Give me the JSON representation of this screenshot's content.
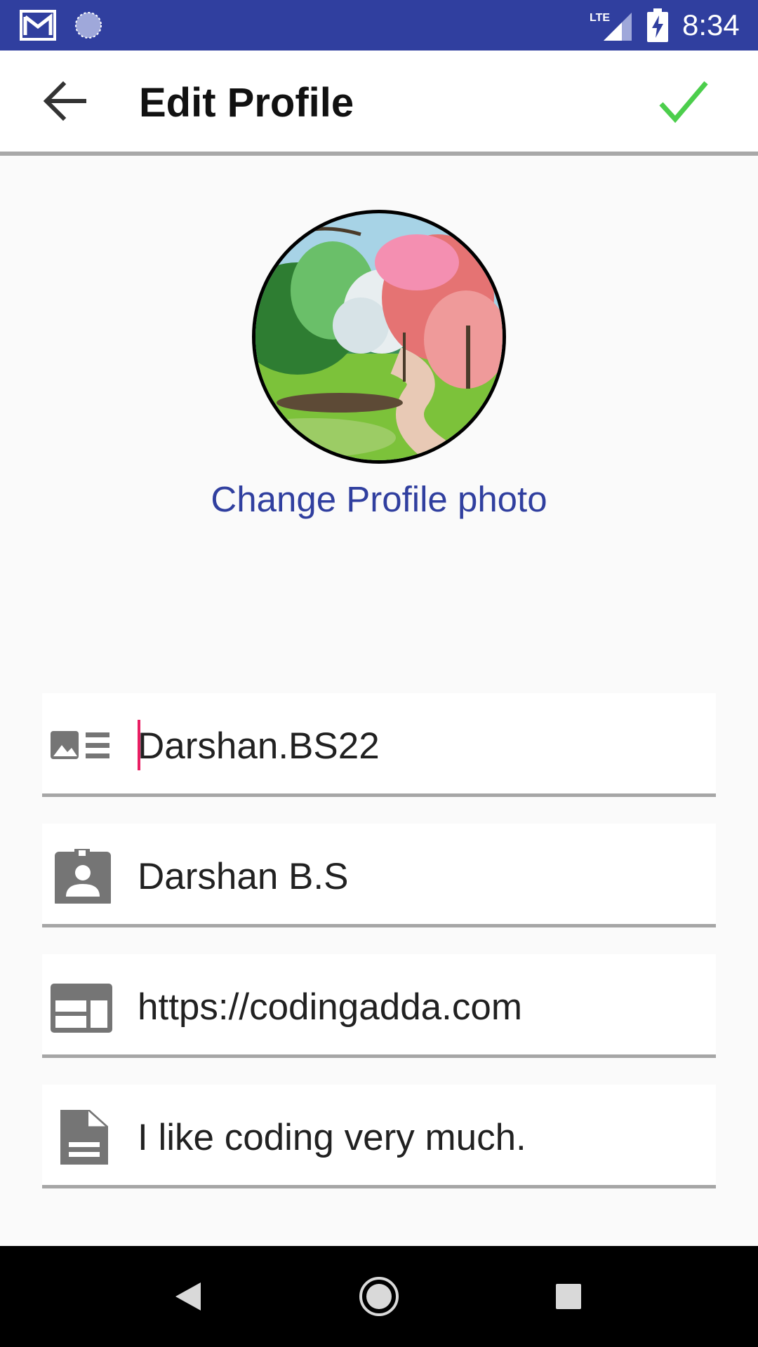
{
  "status_bar": {
    "time": "8:34",
    "network_label": "LTE",
    "background_color": "#303f9f",
    "icons": [
      "gmail-icon",
      "sync-icon",
      "lte-signal-icon",
      "battery-charging-icon"
    ]
  },
  "app_bar": {
    "title": "Edit Profile",
    "back_icon": "arrow-back-icon",
    "save_icon": "check-icon",
    "check_color": "#4cce4c"
  },
  "profile": {
    "change_photo_label": "Change Profile photo",
    "link_color": "#303f9f"
  },
  "fields": [
    {
      "name": "username",
      "icon": "profile-card-icon",
      "value": "Darshan.BS22",
      "focused": true
    },
    {
      "name": "display_name",
      "icon": "badge-person-icon",
      "value": "Darshan B.S",
      "focused": false
    },
    {
      "name": "website",
      "icon": "web-icon",
      "value": "https://codingadda.com",
      "focused": false
    },
    {
      "name": "description",
      "icon": "document-icon",
      "value": "I like coding very much.",
      "focused": false
    }
  ],
  "nav_bar": {
    "icons": [
      "nav-back-icon",
      "nav-home-icon",
      "nav-recents-icon"
    ]
  }
}
